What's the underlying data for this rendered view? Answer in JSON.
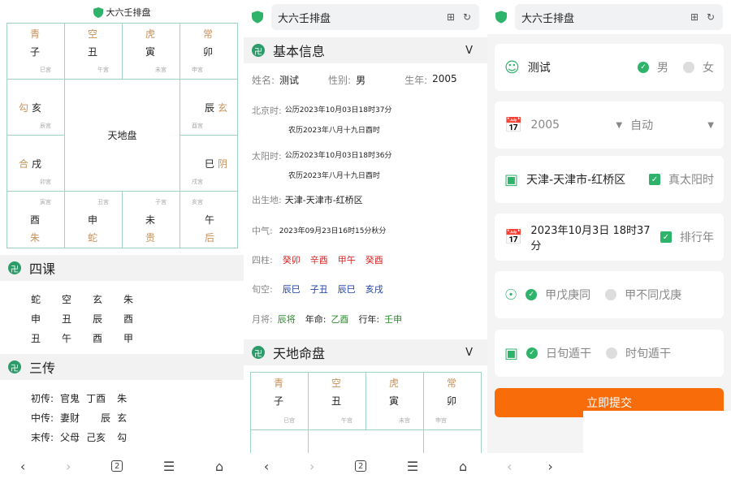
{
  "app_title": "大六壬排盘",
  "p1": {
    "top": [
      {
        "god": "青",
        "branch": "子",
        "palace": "巳宮"
      },
      {
        "god": "空",
        "branch": "丑",
        "palace": "午宮"
      },
      {
        "god": "虎",
        "branch": "寅",
        "palace": "未宮"
      },
      {
        "god": "常",
        "branch": "卯",
        "palace": "申宮"
      }
    ],
    "left": [
      {
        "god": "勾",
        "branch": "亥",
        "palace": "辰宮"
      },
      {
        "god": "合",
        "branch": "戌",
        "palace": "卯宮"
      }
    ],
    "right": [
      {
        "god": "玄",
        "branch": "辰",
        "palace": "酉宮"
      },
      {
        "god": "阴",
        "branch": "巳",
        "palace": "戌宮"
      }
    ],
    "bottom": [
      {
        "god": "朱",
        "branch": "酉",
        "palace": "寅宮"
      },
      {
        "god": "蛇",
        "branch": "申",
        "palace": "丑宮"
      },
      {
        "god": "贵",
        "branch": "未",
        "palace": "子宮"
      },
      {
        "god": "后",
        "branch": "午",
        "palace": "亥宮"
      }
    ],
    "center": "天地盘",
    "sike_title": "四课",
    "sike": [
      [
        "蛇",
        "空",
        "玄",
        "朱"
      ],
      [
        "申",
        "丑",
        "辰",
        "酉"
      ],
      [
        "丑",
        "午",
        "酉",
        "甲"
      ]
    ],
    "sanchuan_title": "三传",
    "sanchuan": [
      {
        "label": "初传:",
        "kin": "官鬼",
        "stem": "丁酉",
        "god": "朱"
      },
      {
        "label": "中传:",
        "kin": "妻财",
        "stem": "辰",
        "god": "玄"
      },
      {
        "label": "末传:",
        "kin": "父母",
        "stem": "己亥",
        "god": "勾"
      }
    ]
  },
  "p2": {
    "url": "大六壬排盘",
    "basic_title": "基本信息",
    "chev": "V",
    "name_label": "姓名:",
    "name": "测试",
    "sex_label": "性别:",
    "sex": "男",
    "year_label": "生年:",
    "year": "2005",
    "bj_label": "北京时:",
    "bj_solar": "公历2023年10月03日18时37分",
    "bj_lunar": "农历2023年八月十九日酉时",
    "ty_label": "太阳时:",
    "ty_solar": "公历2023年10月03日18时36分",
    "ty_lunar": "农历2023年八月十九日酉时",
    "place_label": "出生地:",
    "place": "天津-天津市-红桥区",
    "qi_label": "中气:",
    "qi": "2023年09月23日16时15分秋分",
    "pillars_label": "四柱:",
    "pillars": [
      "癸卯",
      "辛酉",
      "甲午",
      "癸酉"
    ],
    "xunkong_label": "旬空:",
    "xunkong": [
      "辰巳",
      "子丑",
      "辰巳",
      "亥戌"
    ],
    "yuejiang_label": "月将:",
    "yuejiang": "辰将",
    "ming_label": "年命:",
    "ming": "乙酉",
    "xing_label": "行年:",
    "xing": "壬申",
    "tiandi_title": "天地命盘",
    "mini_top": [
      {
        "god": "青",
        "branch": "子",
        "palace": "巳宫"
      },
      {
        "god": "空",
        "branch": "丑",
        "palace": "午宫"
      },
      {
        "god": "虎",
        "branch": "寅",
        "palace": "未宫"
      },
      {
        "god": "常",
        "branch": "卯",
        "palace": "申宫"
      }
    ]
  },
  "p3": {
    "url": "大六壬排盘",
    "name": "测试",
    "male": "男",
    "female": "女",
    "year": "2005",
    "auto": "自动",
    "place": "天津-天津市-红桥区",
    "true_solar": "真太阳时",
    "datetime": "2023年10月3日 18时37分",
    "paihang": "排行年",
    "opt1": "甲戊庚同",
    "opt2": "甲不同戊庚",
    "opt3": "日旬遁干",
    "opt4": "时旬遁干",
    "submit": "立即提交"
  },
  "tabs_count": "2"
}
